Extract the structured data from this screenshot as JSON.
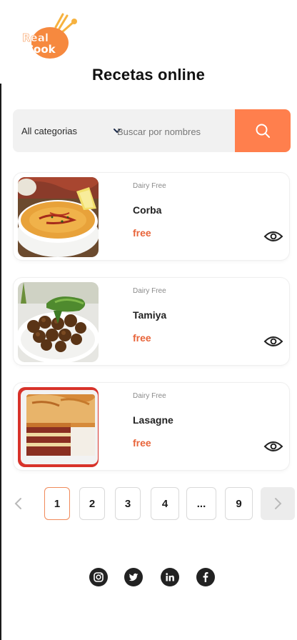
{
  "brand": {
    "logo_line1": "Real",
    "logo_line2": "Cook"
  },
  "page_title": "Recetas online",
  "search": {
    "category": "All categorias",
    "placeholder": "Buscar por nombres"
  },
  "recipes": [
    {
      "tag": "Dairy Free",
      "name": "Corba",
      "price": "free",
      "image": "soup-bowl"
    },
    {
      "tag": "Dairy Free",
      "name": "Tamiya",
      "price": "free",
      "image": "falafel-plate"
    },
    {
      "tag": "Dairy Free",
      "name": "Lasagne",
      "price": "free",
      "image": "lasagne-dish"
    }
  ],
  "pagination": {
    "pages": [
      "1",
      "2",
      "3",
      "4",
      "...",
      "9"
    ],
    "current": "1"
  },
  "social": [
    "instagram-icon",
    "twitter-icon",
    "linkedin-icon",
    "facebook-icon"
  ],
  "colors": {
    "accent": "#ff7f4d",
    "price": "#e8643a",
    "logo": "#f6893f"
  }
}
